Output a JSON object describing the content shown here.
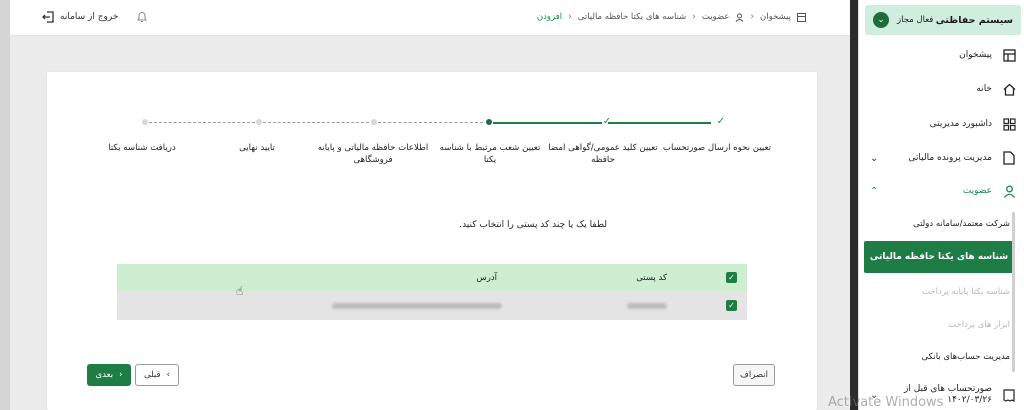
{
  "header": {
    "logout_label": "خروج از سامانه",
    "breadcrumb": [
      "پیشخوان",
      "عضویت",
      "شناسه های یکتا حافظه مالیاتی",
      "افزودن"
    ]
  },
  "sidebar": {
    "system_title": "سیستم حفاظتی",
    "system_status": "فعال مجاز",
    "items": [
      {
        "label": "پیشخوان",
        "icon": "dashboard-icon"
      },
      {
        "label": "خانه",
        "icon": "home-icon"
      },
      {
        "label": "داشبورد مدیریتی",
        "icon": "grid-icon"
      },
      {
        "label": "مدیریت پرونده مالیاتی",
        "icon": "file-icon"
      },
      {
        "label": "عضویت",
        "icon": "user-icon"
      }
    ],
    "sub_items": [
      {
        "label": "شرکت معتمد/سامانه دولتی",
        "disabled": false
      },
      {
        "label": "شناسه های یکتا حافظه مالیاتی",
        "active": true
      },
      {
        "label": "شناسه یکتا پایانه پرداخت",
        "disabled": true
      },
      {
        "label": "ابزار های پرداخت",
        "disabled": true
      },
      {
        "label": "مدیریت حساب‌های بانکی",
        "disabled": false
      }
    ],
    "bottom_item": {
      "label": "صورتحساب های قبل از",
      "date": "۱۴۰۲/۰۳/۲۶"
    }
  },
  "stepper": {
    "steps": [
      {
        "label": "تعیین نحوه ارسال صورتحساب",
        "state": "done"
      },
      {
        "label": "تعیین کلید عمومی/گواهی امضا حافظه",
        "state": "done"
      },
      {
        "label": "تعیین شعب مرتبط با شناسه یکتا",
        "state": "current"
      },
      {
        "label": "اطلاعات حافظه مالیاتی و پایانه فروشگاهی",
        "state": "todo"
      },
      {
        "label": "تایید نهایی",
        "state": "todo"
      },
      {
        "label": "دریافت شناسه یکتا",
        "state": "todo"
      }
    ]
  },
  "form": {
    "instruction": "لطفا یک یا چند کد پستی را انتخاب کنید.",
    "table": {
      "headers": {
        "postal_code": "کد پستی",
        "address": "آدرس"
      }
    }
  },
  "buttons": {
    "next": "بعدی",
    "prev": "قبلی",
    "cancel": "انصراف"
  },
  "watermark": "Activate Windows",
  "colors": {
    "primary": "#1e7d45",
    "header_green": "#cfeedd",
    "table_head": "#cdeed0"
  }
}
